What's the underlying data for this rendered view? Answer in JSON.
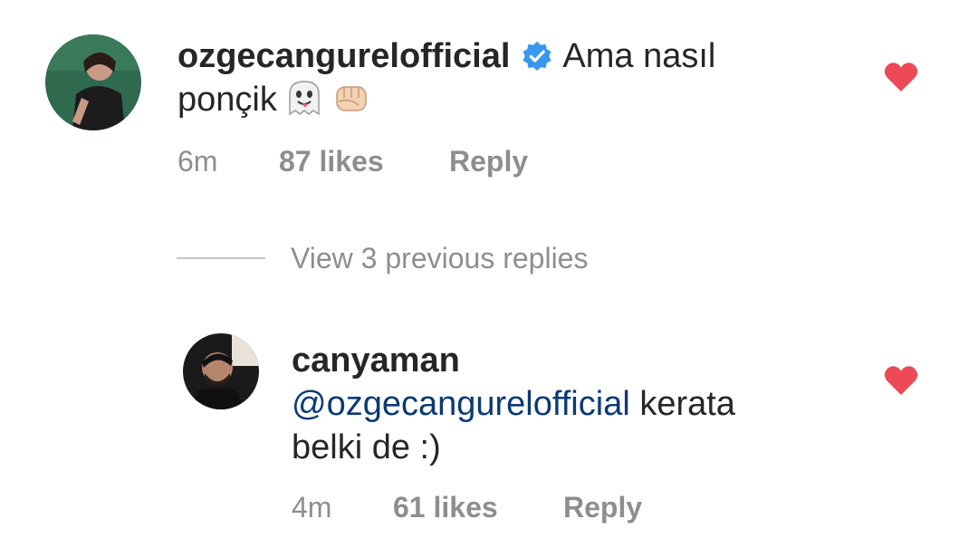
{
  "comments": [
    {
      "username": "ozgecangurelofficial",
      "verified": true,
      "text": "Ama nasıl ponçik",
      "emojis": [
        "ghost-emoji",
        "fist-emoji"
      ],
      "time": "6m",
      "likes": "87 likes",
      "reply_label": "Reply",
      "liked": true
    },
    {
      "username": "canyaman",
      "mention": "@ozgecangurelofficial",
      "text": "kerata belki de :)",
      "time": "4m",
      "likes": "61 likes",
      "reply_label": "Reply",
      "liked": true
    }
  ],
  "view_replies_label": "View 3 previous replies",
  "colors": {
    "heart": "#ed4956",
    "verified": "#3897f0",
    "mention": "#0b3a74",
    "meta": "#8e8e8e"
  }
}
